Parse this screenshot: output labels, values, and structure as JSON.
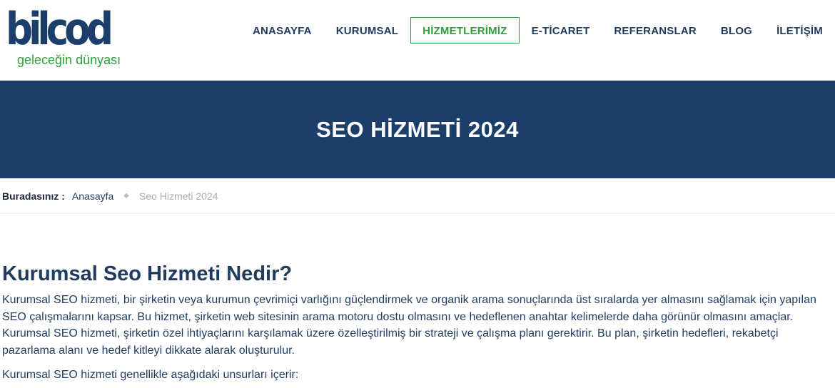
{
  "logo": {
    "word": "bilcod",
    "tagline": "geleceğin dünyası"
  },
  "nav": {
    "items": [
      {
        "label": "ANASAYFA"
      },
      {
        "label": "KURUMSAL"
      },
      {
        "label": "HİZMETLERİMİZ",
        "active": true
      },
      {
        "label": "E-TİCARET"
      },
      {
        "label": "REFERANSLAR"
      },
      {
        "label": "BLOG"
      },
      {
        "label": "İLETİŞİM"
      }
    ]
  },
  "banner": {
    "title": "SEO HİZMETİ 2024"
  },
  "breadcrumb": {
    "label": "Buradasınız :",
    "home": "Anasayfa",
    "separator": "◆",
    "current": "Seo Hizmeti 2024"
  },
  "article": {
    "heading": "Kurumsal Seo Hizmeti Nedir?",
    "paragraph1": "Kurumsal SEO hizmeti, bir şirketin veya kurumun çevrimiçi varlığını güçlendirmek ve organik arama sonuçlarında üst sıralarda yer almasını sağlamak için yapılan SEO çalışmalarını kapsar. Bu hizmet, şirketin web sitesinin arama motoru dostu olmasını ve hedeflenen anahtar kelimelerde daha görünür olmasını amaçlar. Kurumsal SEO hizmeti, şirketin özel ihtiyaçlarını karşılamak üzere özelleştirilmiş bir strateji ve çalışma planı gerektirir. Bu plan, şirketin hedefleri, rekabetçi pazarlama alanı ve hedef kitleyi dikkate alarak oluşturulur.",
    "paragraph2": "Kurumsal SEO hizmeti genellikle aşağıdaki unsurları içerir:"
  },
  "colors": {
    "navy": "#1b3e6b",
    "green": "#2e9f3a",
    "text": "#1f3b5e"
  }
}
